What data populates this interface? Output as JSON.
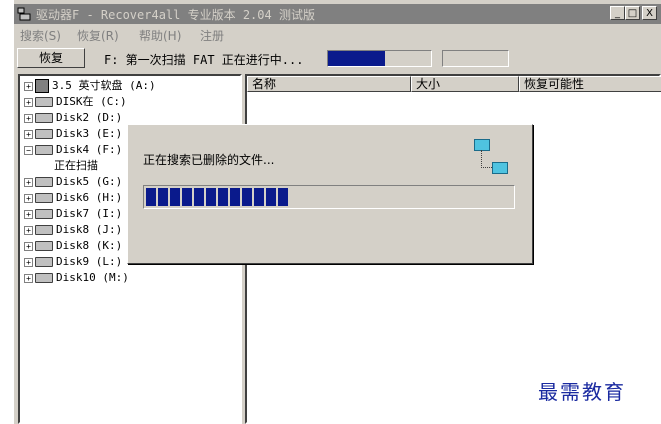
{
  "window": {
    "title": "驱动器F  - Recover4all 专业版本 2.04 测试版",
    "buttons": {
      "minimize": "_",
      "maximize": "□",
      "close": "X"
    }
  },
  "menu": {
    "items": [
      {
        "label": "搜索(S)"
      },
      {
        "label": "恢复(R)"
      },
      {
        "label": "帮助(H)"
      },
      {
        "label": "注册"
      }
    ]
  },
  "toolbar": {
    "recover_label": "恢复",
    "status_text": "F: 第一次扫描 FAT 正在进行中...",
    "progress": 0.55,
    "progress_color": "#0a1a8c"
  },
  "tree": {
    "items": [
      {
        "label": "3.5 英寸软盘 (A:)",
        "icon": "floppy-icon"
      },
      {
        "label": "DISK在 (C:)",
        "icon": "drive-icon"
      },
      {
        "label": "Disk2 (D:)",
        "icon": "drive-icon"
      },
      {
        "label": "Disk3 (E:)",
        "icon": "drive-icon"
      },
      {
        "label": "Disk4 (F:)",
        "icon": "drive-icon",
        "expanded": true
      },
      {
        "label": "正在扫描",
        "child": true
      },
      {
        "label": "Disk5 (G:)",
        "icon": "drive-icon"
      },
      {
        "label": "Disk6 (H:)",
        "icon": "drive-icon"
      },
      {
        "label": "Disk7 (I:)",
        "icon": "drive-icon"
      },
      {
        "label": "Disk8 (J:)",
        "icon": "drive-icon"
      },
      {
        "label": "Disk8 (K:)",
        "icon": "drive-icon"
      },
      {
        "label": "Disk9 (L:)",
        "icon": "drive-icon"
      },
      {
        "label": "Disk10 (M:)",
        "icon": "drive-icon"
      }
    ]
  },
  "list": {
    "columns": [
      "名称",
      "大小",
      "恢复可能性"
    ]
  },
  "dialog": {
    "message": "正在搜索已删除的文件...",
    "progress_blocks": 12
  },
  "watermark": "最需教育"
}
